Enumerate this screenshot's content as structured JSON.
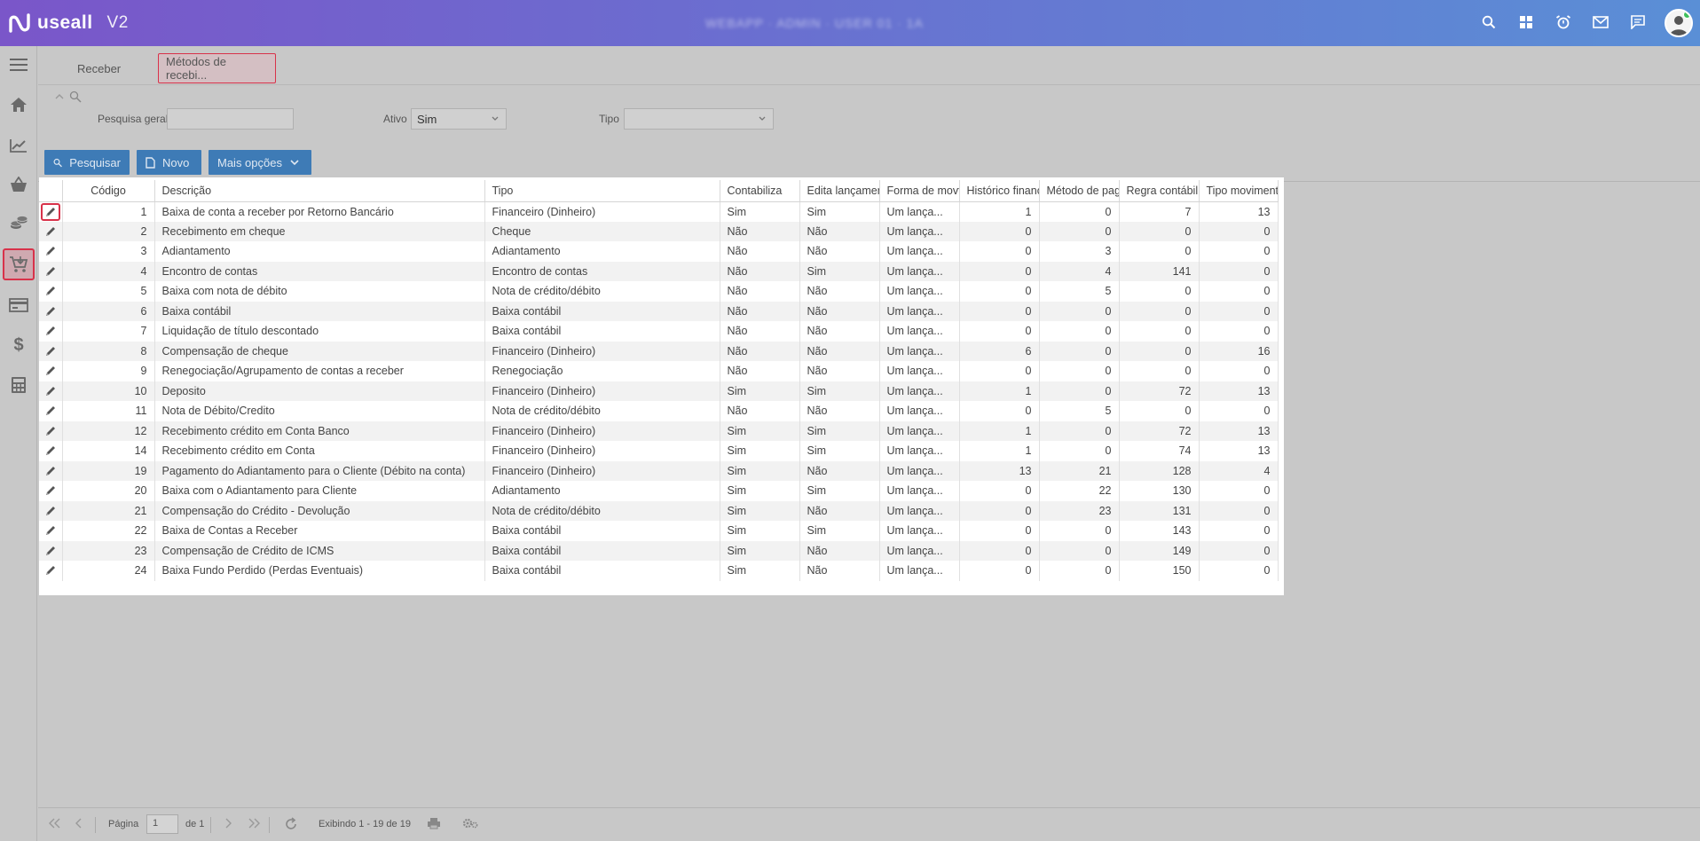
{
  "header": {
    "brand": "useall",
    "version": "V2",
    "center_text": "WEBAPP · ADMIN · USER 01 · 1A",
    "avatar_online_color": "#3fbf5c",
    "icons": [
      "search-icon",
      "grid-icon",
      "alarm-icon",
      "mail-icon",
      "chat-icon"
    ]
  },
  "sidebar": {
    "items": [
      "menu-icon",
      "home-icon",
      "chart-line-icon",
      "basket-icon",
      "coins-icon",
      "cart-icon",
      "card-icon",
      "dollar-icon",
      "calculator-icon"
    ],
    "active": "cart-icon"
  },
  "tabs": [
    {
      "label": "Receber",
      "active": false
    },
    {
      "label": "Métodos de recebi...",
      "active": true
    }
  ],
  "filters": {
    "general_search_label": "Pesquisa geral",
    "general_search_value": "",
    "active_label": "Ativo",
    "active_value": "Sim",
    "type_label": "Tipo",
    "type_value": ""
  },
  "toolbar": {
    "search_label": "Pesquisar",
    "new_label": "Novo",
    "more_label": "Mais opções"
  },
  "grid": {
    "columns": [
      "Código",
      "Descrição",
      "Tipo",
      "Contabiliza",
      "Edita lançament",
      "Forma de movt",
      "Histórico financ",
      "Método de pag",
      "Regra contábil",
      "Tipo movimento"
    ],
    "rows": [
      {
        "codigo": "1",
        "descricao": "Baixa de conta a receber por Retorno Bancário",
        "tipo": "Financeiro (Dinheiro)",
        "contabiliza": "Sim",
        "edita": "Sim",
        "forma": "Um lança...",
        "historico": "1",
        "metodo": "0",
        "regra": "7",
        "tipo_mov": "13"
      },
      {
        "codigo": "2",
        "descricao": "Recebimento em cheque",
        "tipo": "Cheque",
        "contabiliza": "Não",
        "edita": "Não",
        "forma": "Um lança...",
        "historico": "0",
        "metodo": "0",
        "regra": "0",
        "tipo_mov": "0"
      },
      {
        "codigo": "3",
        "descricao": "Adiantamento",
        "tipo": "Adiantamento",
        "contabiliza": "Não",
        "edita": "Não",
        "forma": "Um lança...",
        "historico": "0",
        "metodo": "3",
        "regra": "0",
        "tipo_mov": "0"
      },
      {
        "codigo": "4",
        "descricao": "Encontro de contas",
        "tipo": "Encontro de contas",
        "contabiliza": "Não",
        "edita": "Sim",
        "forma": "Um lança...",
        "historico": "0",
        "metodo": "4",
        "regra": "141",
        "tipo_mov": "0"
      },
      {
        "codigo": "5",
        "descricao": "Baixa com nota de débito",
        "tipo": "Nota de crédito/débito",
        "contabiliza": "Não",
        "edita": "Não",
        "forma": "Um lança...",
        "historico": "0",
        "metodo": "5",
        "regra": "0",
        "tipo_mov": "0"
      },
      {
        "codigo": "6",
        "descricao": "Baixa contábil",
        "tipo": "Baixa contábil",
        "contabiliza": "Não",
        "edita": "Não",
        "forma": "Um lança...",
        "historico": "0",
        "metodo": "0",
        "regra": "0",
        "tipo_mov": "0"
      },
      {
        "codigo": "7",
        "descricao": "Liquidação de título descontado",
        "tipo": "Baixa contábil",
        "contabiliza": "Não",
        "edita": "Não",
        "forma": "Um lança...",
        "historico": "0",
        "metodo": "0",
        "regra": "0",
        "tipo_mov": "0"
      },
      {
        "codigo": "8",
        "descricao": "Compensação de cheque",
        "tipo": "Financeiro (Dinheiro)",
        "contabiliza": "Não",
        "edita": "Não",
        "forma": "Um lança...",
        "historico": "6",
        "metodo": "0",
        "regra": "0",
        "tipo_mov": "16"
      },
      {
        "codigo": "9",
        "descricao": "Renegociação/Agrupamento de contas a receber",
        "tipo": "Renegociação",
        "contabiliza": "Não",
        "edita": "Não",
        "forma": "Um lança...",
        "historico": "0",
        "metodo": "0",
        "regra": "0",
        "tipo_mov": "0"
      },
      {
        "codigo": "10",
        "descricao": "Deposito",
        "tipo": "Financeiro (Dinheiro)",
        "contabiliza": "Sim",
        "edita": "Sim",
        "forma": "Um lança...",
        "historico": "1",
        "metodo": "0",
        "regra": "72",
        "tipo_mov": "13"
      },
      {
        "codigo": "11",
        "descricao": "Nota de Débito/Credito",
        "tipo": "Nota de crédito/débito",
        "contabiliza": "Não",
        "edita": "Não",
        "forma": "Um lança...",
        "historico": "0",
        "metodo": "5",
        "regra": "0",
        "tipo_mov": "0"
      },
      {
        "codigo": "12",
        "descricao": "Recebimento crédito em Conta Banco",
        "tipo": "Financeiro (Dinheiro)",
        "contabiliza": "Sim",
        "edita": "Sim",
        "forma": "Um lança...",
        "historico": "1",
        "metodo": "0",
        "regra": "72",
        "tipo_mov": "13"
      },
      {
        "codigo": "14",
        "descricao": "Recebimento crédito em Conta",
        "tipo": "Financeiro (Dinheiro)",
        "contabiliza": "Sim",
        "edita": "Sim",
        "forma": "Um lança...",
        "historico": "1",
        "metodo": "0",
        "regra": "74",
        "tipo_mov": "13"
      },
      {
        "codigo": "19",
        "descricao": "Pagamento do Adiantamento para o Cliente (Débito na conta)",
        "tipo": "Financeiro (Dinheiro)",
        "contabiliza": "Sim",
        "edita": "Não",
        "forma": "Um lança...",
        "historico": "13",
        "metodo": "21",
        "regra": "128",
        "tipo_mov": "4"
      },
      {
        "codigo": "20",
        "descricao": "Baixa com o Adiantamento para Cliente",
        "tipo": "Adiantamento",
        "contabiliza": "Sim",
        "edita": "Sim",
        "forma": "Um lança...",
        "historico": "0",
        "metodo": "22",
        "regra": "130",
        "tipo_mov": "0"
      },
      {
        "codigo": "21",
        "descricao": "Compensação do Crédito - Devolução",
        "tipo": "Nota de crédito/débito",
        "contabiliza": "Sim",
        "edita": "Não",
        "forma": "Um lança...",
        "historico": "0",
        "metodo": "23",
        "regra": "131",
        "tipo_mov": "0"
      },
      {
        "codigo": "22",
        "descricao": "Baixa de Contas a Receber",
        "tipo": "Baixa contábil",
        "contabiliza": "Sim",
        "edita": "Sim",
        "forma": "Um lança...",
        "historico": "0",
        "metodo": "0",
        "regra": "143",
        "tipo_mov": "0"
      },
      {
        "codigo": "23",
        "descricao": "Compensação de Crédito de ICMS",
        "tipo": "Baixa contábil",
        "contabiliza": "Sim",
        "edita": "Não",
        "forma": "Um lança...",
        "historico": "0",
        "metodo": "0",
        "regra": "149",
        "tipo_mov": "0"
      },
      {
        "codigo": "24",
        "descricao": "Baixa Fundo Perdido (Perdas Eventuais)",
        "tipo": "Baixa contábil",
        "contabiliza": "Sim",
        "edita": "Não",
        "forma": "Um lança...",
        "historico": "0",
        "metodo": "0",
        "regra": "150",
        "tipo_mov": "0"
      }
    ]
  },
  "pager": {
    "page_label": "Página",
    "page_value": "1",
    "of_label": "de 1",
    "showing": "Exibindo 1 - 19 de 19"
  },
  "colors": {
    "accent_selected": "#d8324a",
    "button_blue": "#3e7bb6",
    "header_gradient_start": "#7a56c9",
    "header_gradient_end": "#5a8fd6"
  }
}
